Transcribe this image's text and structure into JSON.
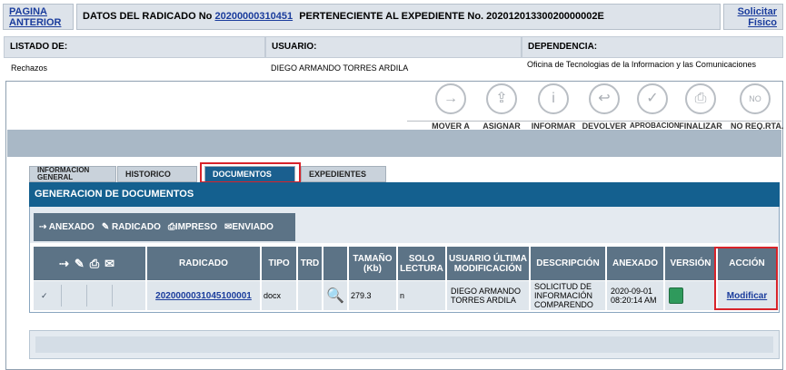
{
  "header": {
    "back_link": "PAGINA ANTERIOR",
    "title_prefix": "DATOS DEL RADICADO No",
    "radicado_no": "20200000310451",
    "title_suffix": "PERTENECIENTE AL EXPEDIENTE No. 20201201330020000002E",
    "physical_request_link": "Solicitar Físico"
  },
  "info": {
    "listado_label": "LISTADO DE:",
    "listado_value": "Rechazos",
    "usuario_label": "USUARIO:",
    "usuario_value": "DIEGO ARMANDO TORRES ARDILA",
    "dependencia_label": "DEPENDENCIA:",
    "dependencia_value": "Oficina de Tecnologias de la Informacion y las Comunicaciones"
  },
  "actions": [
    {
      "label": "MOVER A",
      "icon": "arrow-right-icon"
    },
    {
      "label": "ASIGNAR",
      "icon": "assign-icon"
    },
    {
      "label": "INFORMAR",
      "icon": "info-icon"
    },
    {
      "label": "DEVOLVER",
      "icon": "return-icon"
    },
    {
      "label": "APROBACION",
      "icon": "check-icon"
    },
    {
      "label": "FINALIZAR",
      "icon": "finalize-icon"
    },
    {
      "label": "NO REQ.RTA.",
      "icon": "no-reply-icon"
    }
  ],
  "tabs": {
    "general": "INFORMACION GENERAL",
    "historico": "HISTORICO",
    "documentos": "DOCUMENTOS",
    "expedientes": "EXPEDIENTES"
  },
  "panel": {
    "title": "GENERACION DE DOCUMENTOS",
    "toolbar": {
      "anexado": "ANEXADO",
      "radicado": "RADICADO",
      "impreso": "IMPRESO",
      "enviado": "ENVIADO"
    }
  },
  "table": {
    "headers": {
      "radicado": "RADICADO",
      "tipo": "TIPO",
      "trd": "TRD",
      "tamano": "TAMAÑO (Kb)",
      "solo_lectura": "SOLO LECTURA",
      "usuario": "USUARIO ÚLTIMA MODIFICACIÓN",
      "descripcion": "DESCRIPCIÓN",
      "anexado": "ANEXADO",
      "version": "VERSIÓN",
      "accion": "ACCIÓN"
    },
    "row": {
      "radicado": "2020000031045100001",
      "tipo": "docx",
      "tamano": "279.3",
      "solo_lectura": "n",
      "usuario": "DIEGO ARMANDO TORRES ARDILA",
      "descripcion": "SOLICITUD DE INFORMACIÓN COMPARENDO",
      "anexado": "2020-09-01 08:20:14 AM",
      "accion": "Modificar"
    }
  },
  "colors": {
    "panel_header": "#14608f",
    "table_header": "#5c7386",
    "highlight": "#d8232a",
    "link": "#1a3c9c"
  }
}
